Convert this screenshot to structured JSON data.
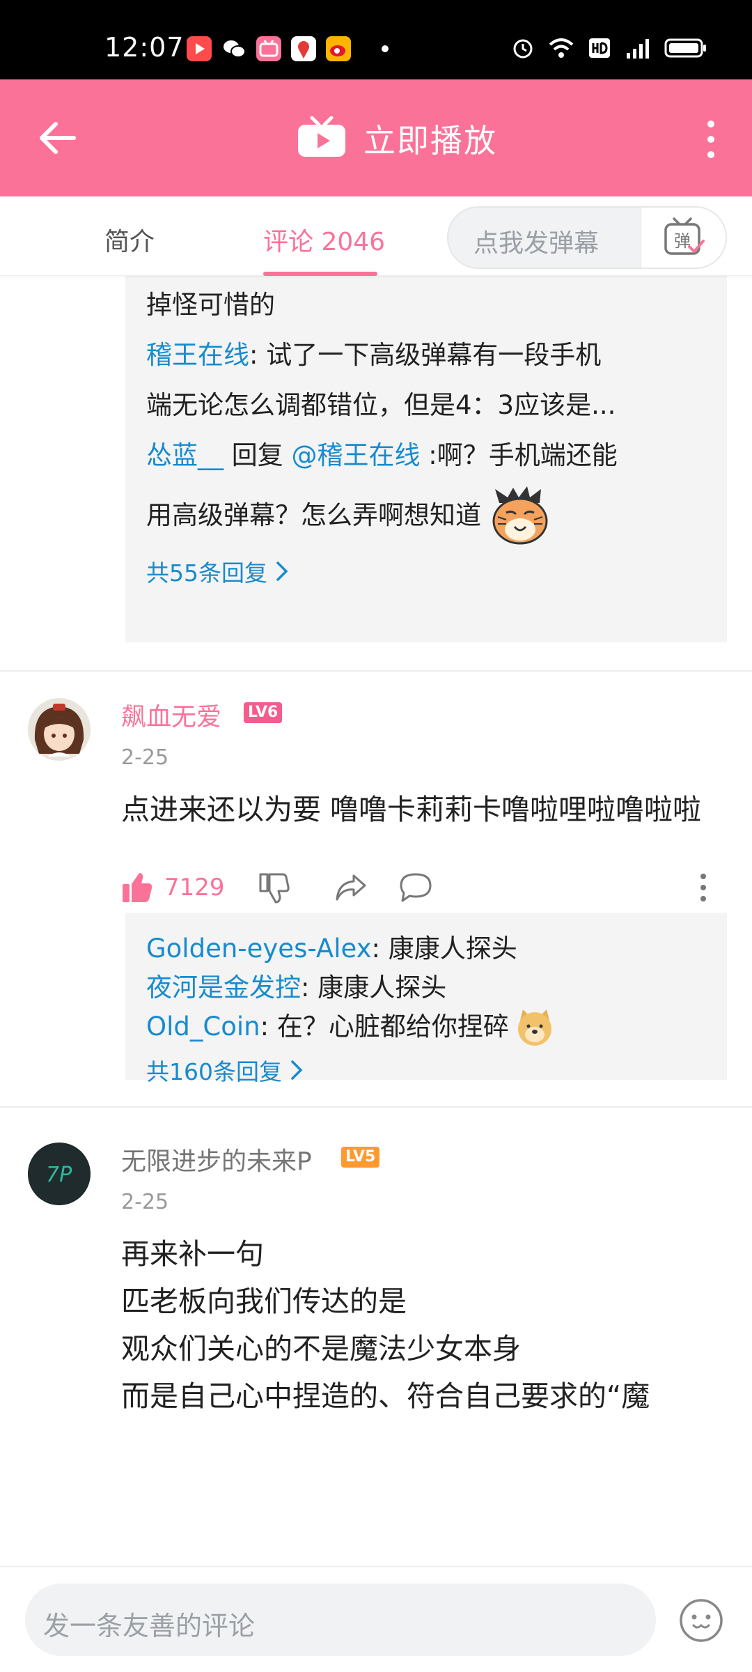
{
  "status_bar": {
    "time": "12:07"
  },
  "app_bar": {
    "title": "立即播放"
  },
  "tabs": {
    "intro": "简介",
    "comments": "评论 2046",
    "danmaku_placeholder": "点我发弹幕",
    "danmaku_button": "弹"
  },
  "thread1": {
    "tail_text": "掉怪可惜的",
    "replies": [
      {
        "user": "稽王在线",
        "text": ": 试了一下高级弹幕有一段手机"
      },
      {
        "cont": "端无论怎么调都错位，但是4：3应该是..."
      },
      {
        "user": "怂蓝__",
        "mid": " 回复 ",
        "mention": "@稽王在线",
        "text": " :啊？手机端还能"
      },
      {
        "cont": "用高级弹幕？怎么弄啊想知道"
      }
    ],
    "more": "共55条回复"
  },
  "comment1": {
    "name": "飙血无爱",
    "level": "LV6",
    "date": "2-25",
    "text": "点进来还以为要 噜噜卡莉莉卡噜啦哩啦噜啦啦",
    "likes": "7129",
    "replies": [
      {
        "user": "Golden-eyes-Alex",
        "text": ": 康康人探头"
      },
      {
        "user": "夜河是金发控",
        "text": ": 康康人探头"
      },
      {
        "user": "Old_Coin",
        "text": ": 在？心脏都给你捏碎"
      }
    ],
    "more": "共160条回复"
  },
  "comment2": {
    "name": "无限进步的未来P",
    "level": "LV5",
    "date": "2-25",
    "lines": [
      "再来补一句",
      "匹老板向我们传达的是",
      "观众们关心的不是魔法少女本身",
      "而是自己心中捏造的、符合自己要求的“魔"
    ],
    "avatar_text": "7P"
  },
  "bottom": {
    "placeholder": "发一条友善的评论"
  },
  "colors": {
    "brand_pink": "#fb7299",
    "link_blue": "#178bcf",
    "lv6": "#f25d8e",
    "lv5": "#ff9a2e"
  }
}
